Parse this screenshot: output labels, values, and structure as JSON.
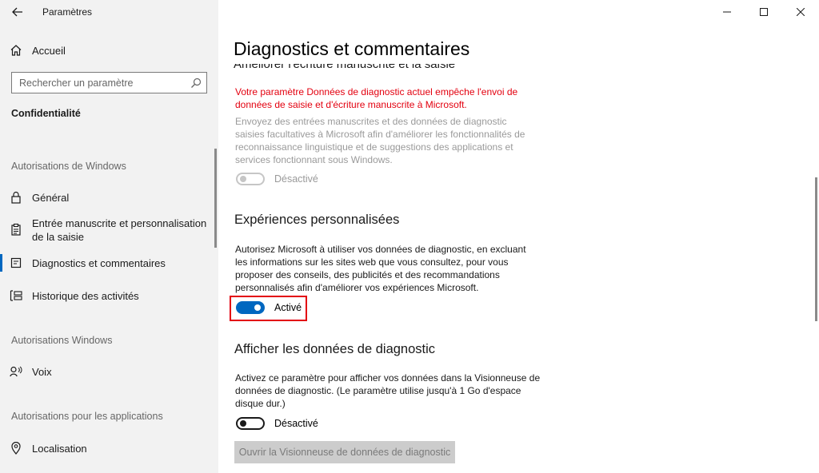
{
  "window": {
    "app_title": "Paramètres"
  },
  "sidebar": {
    "home_label": "Accueil",
    "search_placeholder": "Rechercher un paramètre",
    "section_title": "Confidentialité",
    "groups": {
      "windows_permissions": "Autorisations de Windows",
      "windows_permissions_2": "Autorisations Windows",
      "app_permissions": "Autorisations pour les applications"
    },
    "items": {
      "general": "Général",
      "inking": "Entrée manuscrite et personnalisation de la saisie",
      "diagnostics": "Diagnostics et commentaires",
      "activity": "Historique des activités",
      "voice": "Voix",
      "location": "Localisation"
    },
    "selected_item": "diagnostics"
  },
  "main": {
    "page_title": "Diagnostics et commentaires",
    "clipped_heading": "Améliorer l'écriture manuscrite et la saisie",
    "inking_section": {
      "warning": "Votre paramètre Données de diagnostic actuel empêche l'envoi de données de saisie et d'écriture manuscrite à Microsoft.",
      "description": "Envoyez des entrées manuscrites et des données de diagnostic saisies facultatives à Microsoft afin d'améliorer les fonctionnalités de reconnaissance linguistique et de suggestions des applications et services fonctionnant sous Windows.",
      "toggle_state": "Désactivé"
    },
    "tailored_section": {
      "heading": "Expériences personnalisées",
      "description": "Autorisez Microsoft à utiliser vos données de diagnostic, en excluant les informations sur les sites web que vous consultez, pour vous proposer des conseils, des publicités et des recommandations personnalisés afin d'améliorer vos expériences Microsoft.",
      "toggle_state": "Activé"
    },
    "viewer_section": {
      "heading": "Afficher les données de diagnostic",
      "description": "Activez ce paramètre pour afficher vos données dans la Visionneuse de données de diagnostic. (Le paramètre utilise jusqu'à 1 Go d'espace disque dur.)",
      "toggle_state": "Désactivé",
      "button_label": "Ouvrir la Visionneuse de données de diagnostic"
    }
  },
  "colors": {
    "accent": "#0067c0",
    "warning": "#e3000f",
    "sidebar_bg": "#f2f2f2"
  }
}
